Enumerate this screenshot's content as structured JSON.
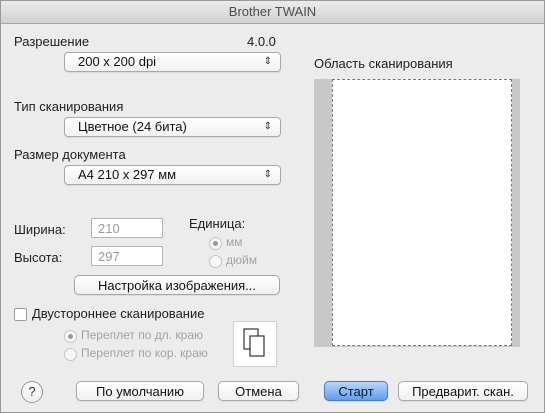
{
  "window": {
    "title": "Brother TWAIN"
  },
  "resolution": {
    "label": "Разрешение",
    "value": "200 x 200 dpi",
    "version": "4.0.0"
  },
  "scan_type": {
    "label": "Тип сканирования",
    "value": "Цветное (24 бита)"
  },
  "doc_size": {
    "label": "Размер документа",
    "value": "A4  210 x 297 мм"
  },
  "width": {
    "label": "Ширина:",
    "value": "210"
  },
  "height": {
    "label": "Высота:",
    "value": "297"
  },
  "unit": {
    "label": "Единица:",
    "mm": "мм",
    "inch": "дюйм",
    "selected": "мм"
  },
  "image_settings_button": "Настройка изображения...",
  "duplex": {
    "label": "Двустороннее сканирование",
    "checked": false,
    "long_edge": "Переплет по дл. краю",
    "short_edge": "Переплет по кор. краю",
    "selected": "long_edge"
  },
  "scan_area": {
    "label": "Область сканирования"
  },
  "buttons": {
    "help": "?",
    "default": "По умолчанию",
    "cancel": "Отмена",
    "start": "Старт",
    "prescan": "Предварит. скан."
  },
  "icons": {
    "help": "question-icon",
    "popup_arrows": "up-down-arrows-icon",
    "duplex_pages": "duplex-pages-icon"
  }
}
